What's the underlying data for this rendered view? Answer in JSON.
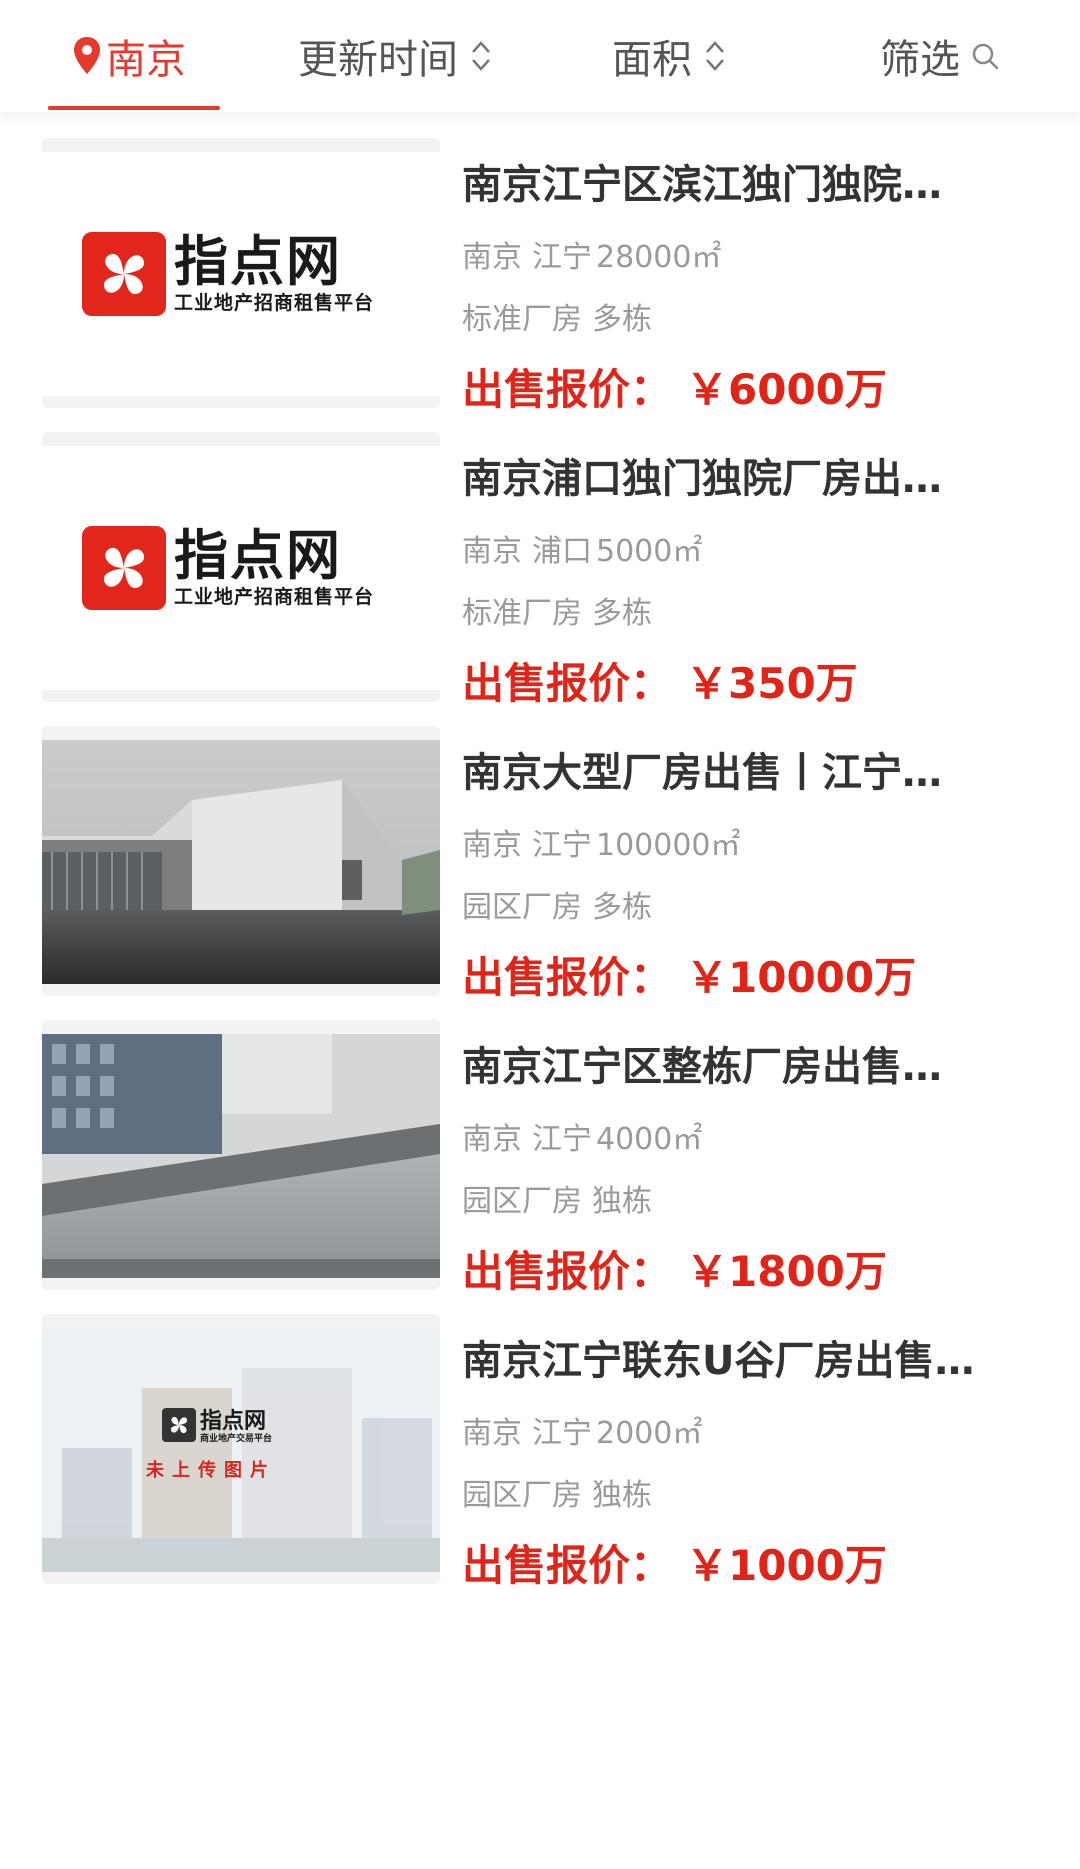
{
  "filters": {
    "city": "南京",
    "update_time": "更新时间",
    "area": "面积",
    "filter": "筛选"
  },
  "logo": {
    "name": "指点网",
    "slogan": "工业地产招商租售平台",
    "slogan_alt": "商业地产交易平台",
    "no_image": "未上传图片"
  },
  "listings": [
    {
      "title": "南京江宁区滨江独门独院…",
      "city": "南京",
      "district": "江宁",
      "area": "28000㎡",
      "type": "标准厂房",
      "building": "多栋",
      "price_label": "出售报价：",
      "price": "￥6000万",
      "image": "logo"
    },
    {
      "title": "南京浦口独门独院厂房出…",
      "city": "南京",
      "district": "浦口",
      "area": "5000㎡",
      "type": "标准厂房",
      "building": "多栋",
      "price_label": "出售报价：",
      "price": "￥350万",
      "image": "logo"
    },
    {
      "title": "南京大型厂房出售丨江宁…",
      "city": "南京",
      "district": "江宁",
      "area": "100000㎡",
      "type": "园区厂房",
      "building": "多栋",
      "price_label": "出售报价：",
      "price": "￥10000万",
      "image": "factory-photo"
    },
    {
      "title": "南京江宁区整栋厂房出售…",
      "city": "南京",
      "district": "江宁",
      "area": "4000㎡",
      "type": "园区厂房",
      "building": "独栋",
      "price_label": "出售报价：",
      "price": "￥1800万",
      "image": "park-sign-photo"
    },
    {
      "title": "南京江宁联东U谷厂房出售…",
      "city": "南京",
      "district": "江宁",
      "area": "2000㎡",
      "type": "园区厂房",
      "building": "独栋",
      "price_label": "出售报价：",
      "price": "￥1000万",
      "image": "no-image-placeholder"
    }
  ],
  "colors": {
    "accent": "#e4392b",
    "price": "#e02418",
    "title": "#333333",
    "meta": "#9a9a9a"
  }
}
